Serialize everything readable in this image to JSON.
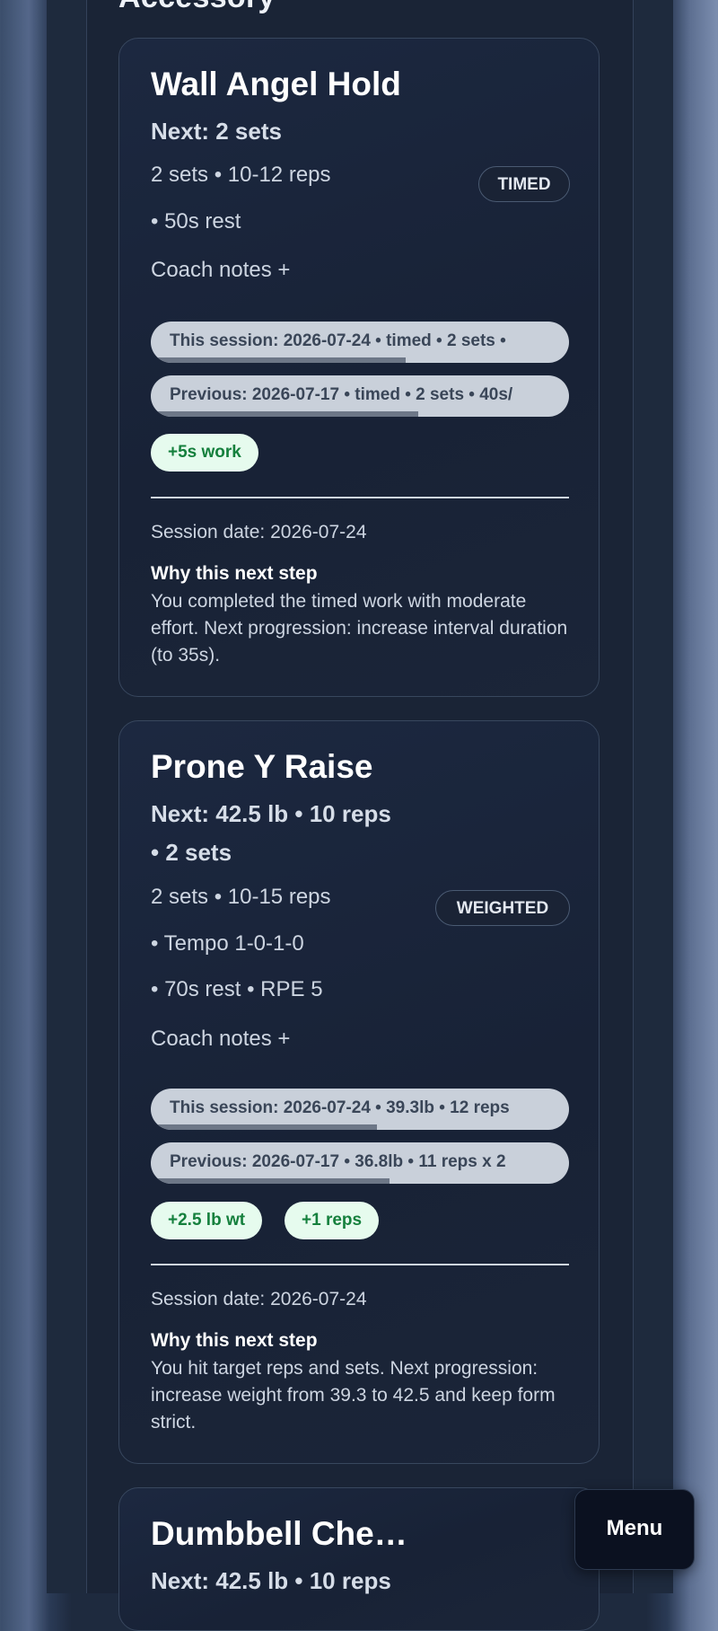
{
  "section": {
    "title": "Accessory"
  },
  "cards": [
    {
      "title": "Wall Angel Hold",
      "next": "Next: 2 sets",
      "lines": [
        "2 sets  •  10-12 reps",
        "•  50s rest"
      ],
      "badge": "TIMED",
      "coach_notes": "Coach notes +",
      "history": [
        {
          "text": "This session: 2026-07-24 • timed • 2 sets •",
          "progress": 0.61
        },
        {
          "text": "Previous: 2026-07-17 • timed • 2 sets • 40s/",
          "progress": 0.64
        }
      ],
      "chips": [
        "+5s work"
      ],
      "session_date": "Session date: 2026-07-24",
      "why_title": "Why this next step",
      "why_text": "You completed the timed work with moderate effort. Next progression: increase interval duration (to 35s)."
    },
    {
      "title": "Prone Y Raise",
      "next_lines": [
        "Next: 42.5 lb • 10 reps",
        "• 2 sets"
      ],
      "lines": [
        "2 sets  •  10-15 reps",
        "•  Tempo 1-0-1-0",
        "•  70s rest  •  RPE 5"
      ],
      "badge": "WEIGHTED",
      "coach_notes": "Coach notes +",
      "history": [
        {
          "text": "This session: 2026-07-24 • 39.3lb • 12 reps",
          "progress": 0.54
        },
        {
          "text": "Previous: 2026-07-17 • 36.8lb • 11 reps x 2",
          "progress": 0.57
        }
      ],
      "chips": [
        "+2.5 lb wt",
        "+1 reps"
      ],
      "session_date": "Session date: 2026-07-24",
      "why_title": "Why this next step",
      "why_text": "You hit target reps and sets. Next progression: increase weight from 39.3 to 42.5 and keep form strict."
    },
    {
      "title": "Dumbbell Che…",
      "next": "Next: 42.5 lb • 10 reps"
    }
  ],
  "menu": {
    "label": "Menu"
  }
}
